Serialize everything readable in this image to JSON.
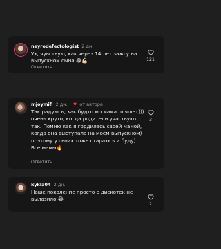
{
  "comments": [
    {
      "username": "neyrodefectologist",
      "time": "2 дн.",
      "text": "Ух, чувствую, как через 14 лет зажгу на выпускном сына 😂💪🏻",
      "reply_label": "Ответить",
      "likes": "121"
    },
    {
      "username": "mjoymifi",
      "time": "2 дн.",
      "separator": "·",
      "author_badge": "от автора",
      "text": "Так радуюсь, как будто мо мама пляшет))) очень круто, когда родители участвуют так. Помню как я гордилась своей мамой, когда она выступала на моём выпускном) поэтому у своих тоже стараюсь и буду). Все мамы🔥",
      "reply_label": "Ответить",
      "likes": "3"
    },
    {
      "username": "kykla04",
      "time": "2 дн.",
      "text": "Наше поколение просто с дискотек не вылазило 😂",
      "likes": "2"
    }
  ],
  "icons": {
    "like": "heart-outline-icon",
    "author_like": "heart-filled-icon"
  },
  "colors": {
    "background": "#1f1f1f",
    "card": "#161616",
    "author_heart": "#ff3040"
  }
}
